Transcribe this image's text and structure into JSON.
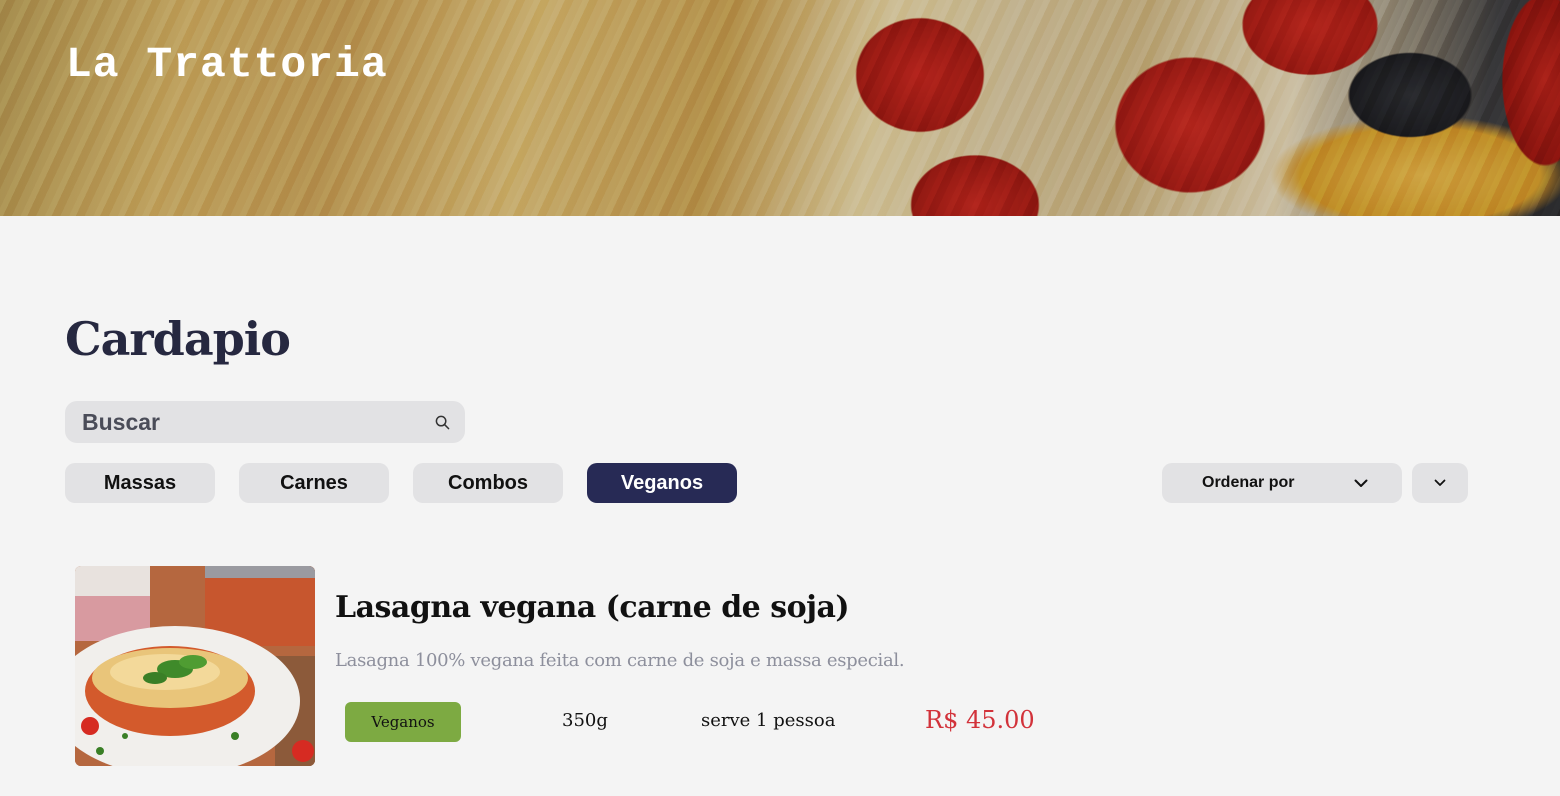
{
  "hero": {
    "title": "La Trattoria"
  },
  "menu": {
    "title": "Cardapio",
    "search": {
      "placeholder": "Buscar"
    },
    "filters": [
      "Massas",
      "Carnes",
      "Combos",
      "Veganos"
    ],
    "active_filter": "Veganos",
    "sort": {
      "label": "Ordenar por"
    }
  },
  "items": [
    {
      "name": "Lasagna vegana (carne de soja)",
      "description": "Lasagna 100% vegana feita com carne de soja e massa especial.",
      "category": "Veganos",
      "weight": "350g",
      "serves": "serve 1 pessoa",
      "price": "R$ 45.00"
    }
  ],
  "colors": {
    "background": "#f4f4f4",
    "active_chip": "#272a55",
    "badge": "#7daa42",
    "price": "#d2323a",
    "title": "#262840"
  },
  "icons": [
    "search-icon",
    "chevron-down-icon"
  ]
}
